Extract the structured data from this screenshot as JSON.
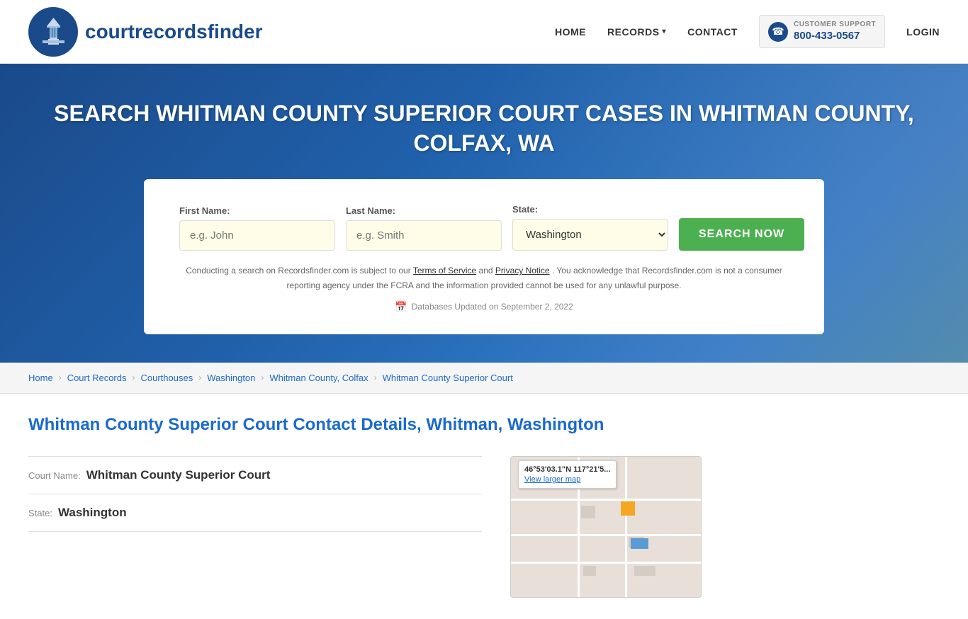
{
  "header": {
    "logo_text_light": "courtrecords",
    "logo_text_bold": "finder",
    "nav": {
      "home": "HOME",
      "records": "RECORDS",
      "contact": "CONTACT",
      "login": "LOGIN"
    },
    "support": {
      "label": "CUSTOMER SUPPORT",
      "phone": "800-433-0567"
    }
  },
  "hero": {
    "title": "SEARCH WHITMAN COUNTY SUPERIOR COURT CASES IN WHITMAN COUNTY, COLFAX, WA",
    "search": {
      "first_name_label": "First Name:",
      "first_name_placeholder": "e.g. John",
      "last_name_label": "Last Name:",
      "last_name_placeholder": "e.g. Smith",
      "state_label": "State:",
      "state_value": "Washington",
      "button_label": "SEARCH NOW"
    },
    "legal": {
      "text1": "Conducting a search on Recordsfinder.com is subject to our",
      "tos": "Terms of Service",
      "and": "and",
      "privacy": "Privacy Notice",
      "text2": ". You acknowledge that Recordsfinder.com is not a consumer reporting agency under the FCRA and the information provided cannot be used for any unlawful purpose."
    },
    "db_updated": "Databases Updated on September 2, 2022"
  },
  "breadcrumb": {
    "items": [
      {
        "label": "Home",
        "link": true
      },
      {
        "label": "Court Records",
        "link": true
      },
      {
        "label": "Courthouses",
        "link": true
      },
      {
        "label": "Washington",
        "link": true
      },
      {
        "label": "Whitman County, Colfax",
        "link": true
      },
      {
        "label": "Whitman County Superior Court",
        "link": false
      }
    ]
  },
  "content": {
    "section_title": "Whitman County Superior Court Contact Details, Whitman, Washington",
    "court_name_label": "Court Name:",
    "court_name_value": "Whitman County Superior Court",
    "state_label": "State:",
    "state_value": "Washington",
    "map": {
      "coords": "46°53'03.1\"N 117°21'5...",
      "view_link": "View larger map"
    }
  }
}
